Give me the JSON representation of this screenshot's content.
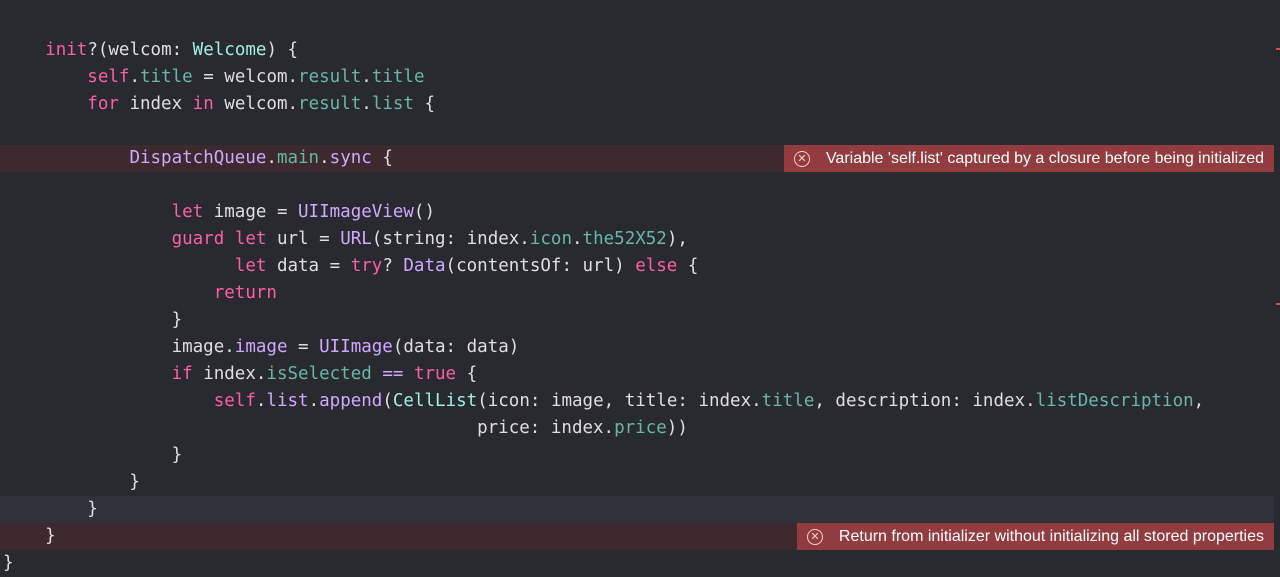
{
  "code_lines": [
    {
      "text": "",
      "parts": []
    },
    {
      "parts": [
        {
          "t": "    ",
          "c": "plain"
        },
        {
          "t": "init",
          "c": "kw"
        },
        {
          "t": "?(welcom: ",
          "c": "plain"
        },
        {
          "t": "Welcome",
          "c": "tyDecl"
        },
        {
          "t": ") {",
          "c": "plain"
        }
      ]
    },
    {
      "parts": [
        {
          "t": "        ",
          "c": "plain"
        },
        {
          "t": "self",
          "c": "kw"
        },
        {
          "t": ".",
          "c": "plain"
        },
        {
          "t": "title",
          "c": "prop"
        },
        {
          "t": " = welcom.",
          "c": "plain"
        },
        {
          "t": "result",
          "c": "prop"
        },
        {
          "t": ".",
          "c": "plain"
        },
        {
          "t": "title",
          "c": "prop"
        }
      ]
    },
    {
      "parts": [
        {
          "t": "        ",
          "c": "plain"
        },
        {
          "t": "for",
          "c": "kw"
        },
        {
          "t": " index ",
          "c": "plain"
        },
        {
          "t": "in",
          "c": "kw"
        },
        {
          "t": " welcom.",
          "c": "plain"
        },
        {
          "t": "result",
          "c": "prop"
        },
        {
          "t": ".",
          "c": "plain"
        },
        {
          "t": "list",
          "c": "prop"
        },
        {
          "t": " {",
          "c": "plain"
        }
      ]
    },
    {
      "parts": []
    },
    {
      "parts": [
        {
          "t": "            ",
          "c": "plain"
        },
        {
          "t": "DispatchQueue",
          "c": "ty"
        },
        {
          "t": ".",
          "c": "plain"
        },
        {
          "t": "main",
          "c": "prop"
        },
        {
          "t": ".",
          "c": "plain"
        },
        {
          "t": "sync",
          "c": "ty"
        },
        {
          "t": " {",
          "c": "plain"
        }
      ]
    },
    {
      "parts": []
    },
    {
      "parts": [
        {
          "t": "                ",
          "c": "plain"
        },
        {
          "t": "let",
          "c": "kw"
        },
        {
          "t": " image = ",
          "c": "plain"
        },
        {
          "t": "UIImageView",
          "c": "ty"
        },
        {
          "t": "()",
          "c": "plain"
        }
      ]
    },
    {
      "parts": [
        {
          "t": "                ",
          "c": "plain"
        },
        {
          "t": "guard",
          "c": "kw"
        },
        {
          "t": " ",
          "c": "plain"
        },
        {
          "t": "let",
          "c": "kw"
        },
        {
          "t": " url = ",
          "c": "plain"
        },
        {
          "t": "URL",
          "c": "ty"
        },
        {
          "t": "(string: index.",
          "c": "plain"
        },
        {
          "t": "icon",
          "c": "prop"
        },
        {
          "t": ".",
          "c": "plain"
        },
        {
          "t": "the52X52",
          "c": "prop"
        },
        {
          "t": "),",
          "c": "plain"
        }
      ]
    },
    {
      "parts": [
        {
          "t": "                      ",
          "c": "plain"
        },
        {
          "t": "let",
          "c": "kw"
        },
        {
          "t": " data = ",
          "c": "plain"
        },
        {
          "t": "try",
          "c": "kw"
        },
        {
          "t": "? ",
          "c": "plain"
        },
        {
          "t": "Data",
          "c": "ty"
        },
        {
          "t": "(contentsOf: url) ",
          "c": "plain"
        },
        {
          "t": "else",
          "c": "kw"
        },
        {
          "t": " {",
          "c": "plain"
        }
      ]
    },
    {
      "parts": [
        {
          "t": "                    ",
          "c": "plain"
        },
        {
          "t": "return",
          "c": "kw"
        }
      ]
    },
    {
      "parts": [
        {
          "t": "                }",
          "c": "plain"
        }
      ]
    },
    {
      "parts": [
        {
          "t": "                image.",
          "c": "plain"
        },
        {
          "t": "image",
          "c": "ty"
        },
        {
          "t": " = ",
          "c": "plain"
        },
        {
          "t": "UIImage",
          "c": "ty"
        },
        {
          "t": "(data: data)",
          "c": "plain"
        }
      ]
    },
    {
      "parts": [
        {
          "t": "                ",
          "c": "plain"
        },
        {
          "t": "if",
          "c": "kw"
        },
        {
          "t": " index.",
          "c": "plain"
        },
        {
          "t": "isSelected",
          "c": "prop"
        },
        {
          "t": " ",
          "c": "plain"
        },
        {
          "t": "==",
          "c": "ty"
        },
        {
          "t": " ",
          "c": "plain"
        },
        {
          "t": "true",
          "c": "kw"
        },
        {
          "t": " {",
          "c": "plain"
        }
      ]
    },
    {
      "parts": [
        {
          "t": "                    ",
          "c": "plain"
        },
        {
          "t": "self",
          "c": "kw"
        },
        {
          "t": ".",
          "c": "plain"
        },
        {
          "t": "list",
          "c": "ty"
        },
        {
          "t": ".",
          "c": "plain"
        },
        {
          "t": "append",
          "c": "ty"
        },
        {
          "t": "(",
          "c": "plain"
        },
        {
          "t": "CellList",
          "c": "tyDecl"
        },
        {
          "t": "(icon: image, title: index.",
          "c": "plain"
        },
        {
          "t": "title",
          "c": "prop"
        },
        {
          "t": ", description: index.",
          "c": "plain"
        },
        {
          "t": "listDescription",
          "c": "prop"
        },
        {
          "t": ",",
          "c": "plain"
        }
      ]
    },
    {
      "parts": [
        {
          "t": "                                             price: index.",
          "c": "plain"
        },
        {
          "t": "price",
          "c": "prop"
        },
        {
          "t": "))",
          "c": "plain"
        }
      ]
    },
    {
      "parts": [
        {
          "t": "                }",
          "c": "plain"
        }
      ]
    },
    {
      "parts": [
        {
          "t": "            }",
          "c": "plain"
        }
      ]
    },
    {
      "parts": [
        {
          "t": "        }",
          "c": "plain"
        }
      ]
    },
    {
      "parts": [
        {
          "t": "    }",
          "c": "plain"
        }
      ]
    },
    {
      "parts": [
        {
          "t": "}",
          "c": "plain"
        }
      ]
    }
  ],
  "issues": [
    {
      "line": 5,
      "message": "Variable 'self.list' captured by a closure before being initialized",
      "icon": "error-circle-x-icon"
    },
    {
      "line": 19,
      "message": "Return from initializer without initializing all stored properties",
      "icon": "error-circle-x-icon"
    }
  ],
  "current_line": 18,
  "colors": {
    "background": "#292a30",
    "keyword": "#fc5fa3",
    "type": "#d0a8ff",
    "property": "#67b7a4",
    "declared_type": "#9ef1dd",
    "error_banner": "#923c3f",
    "error_line": "#3c2a2e"
  }
}
